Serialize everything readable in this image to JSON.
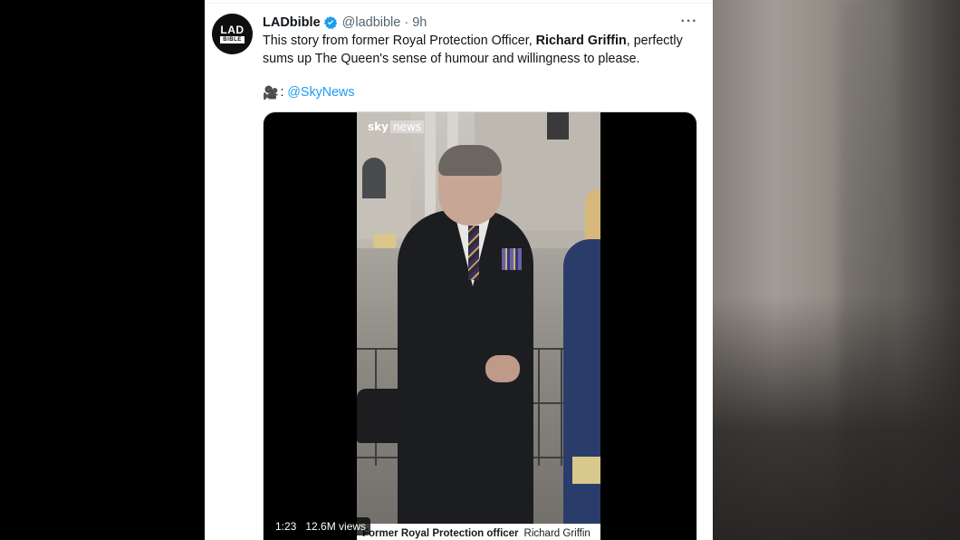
{
  "tweet": {
    "author_name": "LADbible",
    "handle": "@ladbible",
    "separator": "·",
    "time": "9h",
    "more_icon": "···",
    "avatar_text_top": "LAD",
    "avatar_text_bottom": "BIBLE",
    "text_before": "This story from former Royal Protection Officer, ",
    "text_bold": "Richard Griffin",
    "text_after": ", perfectly sums up The Queen's sense of humour and willingness to please.",
    "credit_icon": "🎥",
    "credit_colon": ":",
    "credit_mention": "@SkyNews"
  },
  "video": {
    "duration": "1:23",
    "views": "12.6M views",
    "logo_sky": "sky",
    "logo_news": "news",
    "caption_role": "Former Royal Protection officer",
    "caption_name": "Richard Griffin"
  },
  "colors": {
    "link": "#1d9bf0",
    "verified": "#1d9bf0",
    "text_primary": "#0f1419",
    "text_secondary": "#536471"
  },
  "icons": [
    "verified-badge-icon",
    "more-options-icon",
    "video-camera-icon"
  ]
}
